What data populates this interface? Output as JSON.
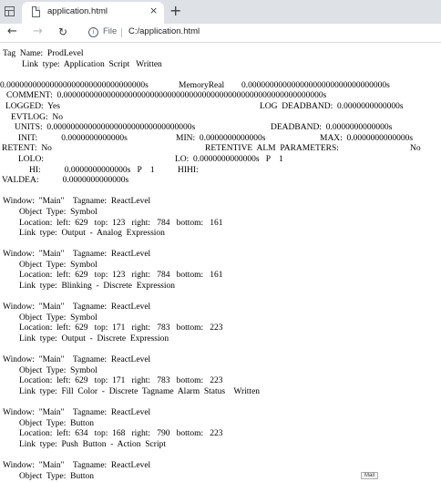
{
  "browser": {
    "tab_title": "application.html",
    "new_tab": "+",
    "close": "×",
    "scheme_label": "File",
    "address": "C:/application.html"
  },
  "tag": {
    "line1": "Tag  Name:  ProdLevel",
    "line2": "Link  type:  Application  Script   Written"
  },
  "memory": {
    "value_a": "0.00000000000000000000000000000000s",
    "type": "MemoryReal",
    "value_b": "0.00000000000000000000000000000000s"
  },
  "comment": "COMMENT:  0.000000000000000000000000000000000000000000000000000000000000s",
  "logged": {
    "label": "LOGGED:  Yes",
    "deadband": "LOG  DEADBAND:  0.0000000000000s"
  },
  "evtlog": "EVTLOG:  No",
  "units": {
    "label": "UNITS:  0.00000000000000000000000000000000s",
    "deadband": "DEADBAND:  0.0000000000000s"
  },
  "init": {
    "init": "INIT:           0.0000000000000s",
    "min": "MIN:  0.0000000000000s",
    "max": "MAX:  0.0000000000000s"
  },
  "retent": {
    "label": "RETENT:  No",
    "params": "RETENTIVE  ALM  PARAMETERS:",
    "value": "No"
  },
  "lolo": {
    "label": "LOLO:",
    "lo": "LO:  0.0000000000000s   P    1"
  },
  "hi": {
    "hi": "HI:           0.0000000000000s   P    1",
    "hihi": "HIHI:"
  },
  "valdea": "VALDEA:           0.0000000000000s",
  "windows": [
    {
      "header": "Window:  \"Main\"    Tagname:  ReactLevel",
      "object": "Object  Type:  Symbol",
      "location": "Location:  left:  629   top:  123   right:   784   bottom:   161",
      "link": "Link  type:  Output  -  Analog  Expression"
    },
    {
      "header": "Window:  \"Main\"    Tagname:  ReactLevel",
      "object": "Object  Type:  Symbol",
      "location": "Location:  left:  629   top:  123   right:   784   bottom:   161",
      "link": "Link  type:  Blinking  -  Discrete  Expression"
    },
    {
      "header": "Window:  \"Main\"    Tagname:  ReactLevel",
      "object": "Object  Type:  Symbol",
      "location": "Location:  left:  629   top:  171   right:   783   bottom:   223",
      "link": "Link  type:  Output  -  Discrete  Expression"
    },
    {
      "header": "Window:  \"Main\"    Tagname:  ReactLevel",
      "object": "Object  Type:  Symbol",
      "location": "Location:  left:  629   top:  171   right:   783   bottom:   223",
      "link": "Link  type:  Fill  Color  -  Discrete  Tagname  Alarm  Status    Written"
    },
    {
      "header": "Window:  \"Main\"    Tagname:  ReactLevel",
      "object": "Object  Type:  Button",
      "location": "Location:  left:  634   top:  168   right:   790   bottom:   223",
      "link": "Link  type:  Push  Button  -  Action  Script"
    },
    {
      "header": "Window:  \"Main\"    Tagname:  ReactLevel",
      "object": "Object  Type:  Button"
    }
  ],
  "badge": "Mail"
}
